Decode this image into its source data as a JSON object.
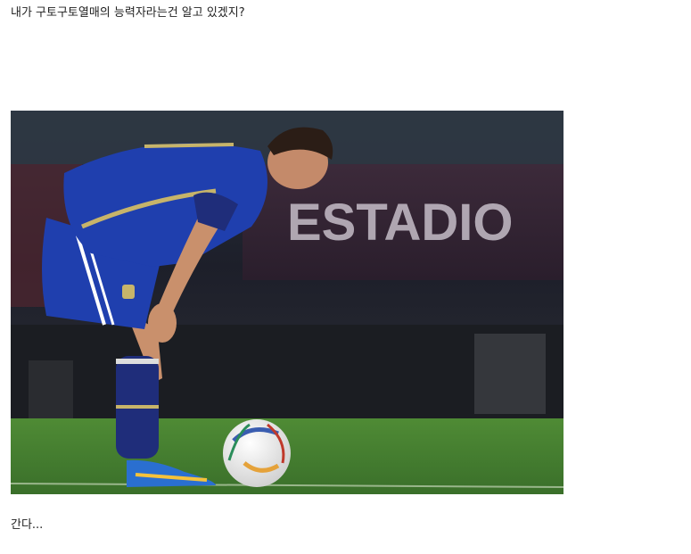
{
  "post": {
    "line1": "내가 구토구토열매의 능력자라는건 알고 있겠지?",
    "line2": "간다..."
  },
  "photo": {
    "banner_text": "ESTADIO",
    "colors": {
      "field": "#3f7a2e",
      "jersey": "#1f3fae",
      "jersey_trim": "#c7b46a",
      "background": "#1d1f2a"
    }
  }
}
